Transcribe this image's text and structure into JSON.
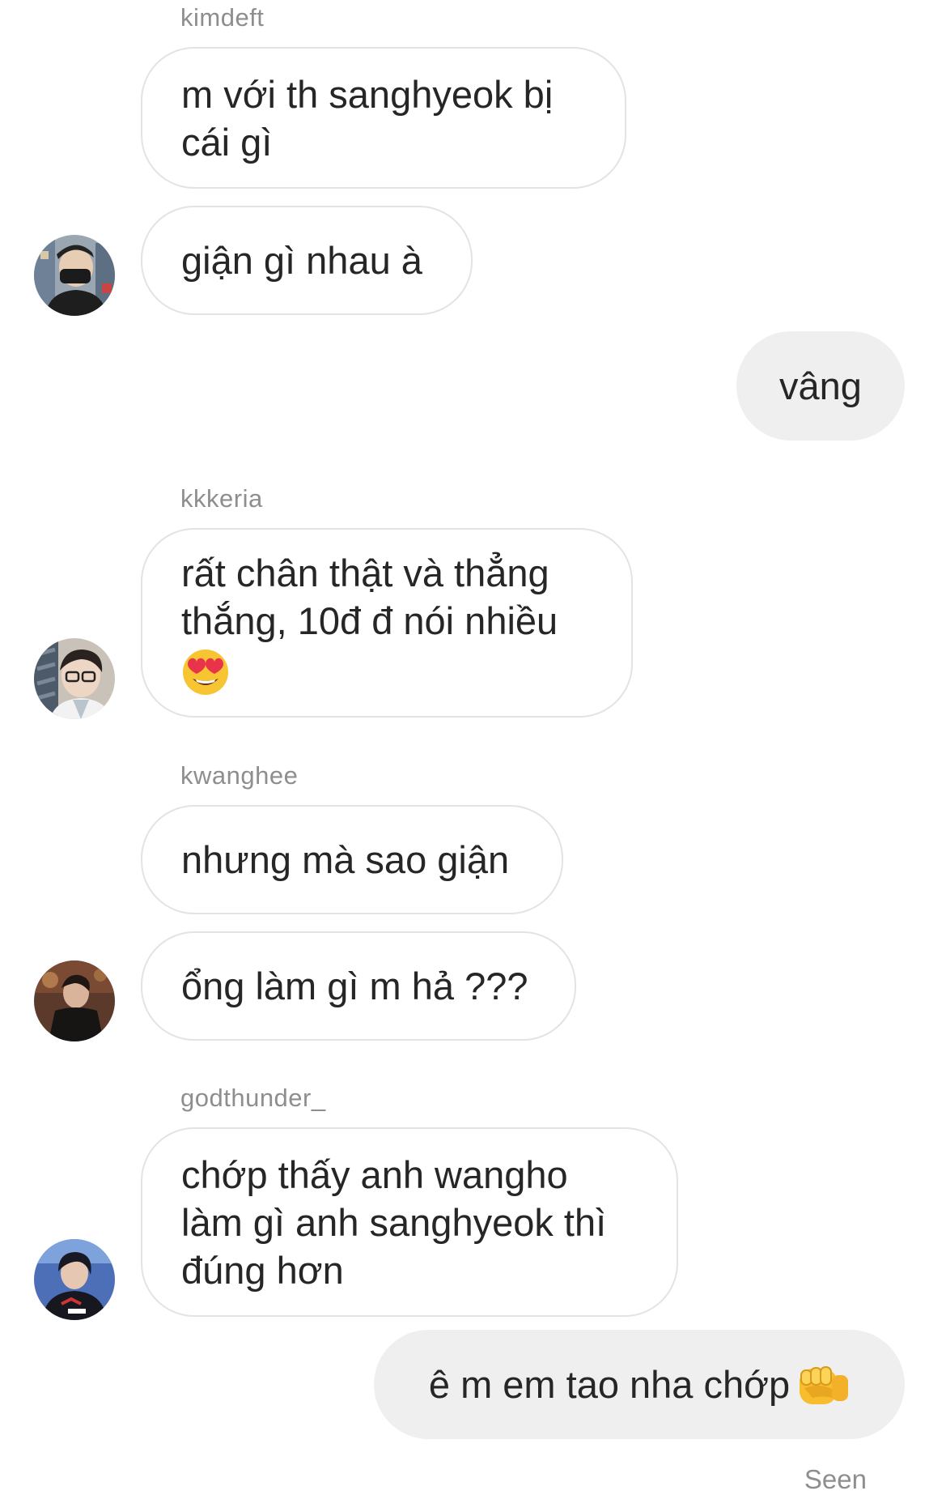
{
  "messages": [
    {
      "sender": "kimdeft",
      "lines": [
        "m với th sanghyeok bị",
        "cái gì"
      ]
    },
    {
      "sender": "kimdeft",
      "lines": [
        "giận gì nhau à"
      ]
    },
    {
      "sender": "me",
      "text": "vâng"
    },
    {
      "sender": "kkkeria",
      "lines": [
        "rất chân thật và thẳng",
        "thắng, 10đ đ nói nhiều"
      ],
      "emoji": "heart-eyes-emoji"
    },
    {
      "sender": "kwanghee",
      "lines": [
        "nhưng mà sao giận"
      ]
    },
    {
      "sender": "kwanghee",
      "lines": [
        "ổng làm gì m hả ???"
      ]
    },
    {
      "sender": "godthunder_",
      "lines": [
        "chớp thấy anh wangho",
        "làm gì anh sanghyeok thì",
        "đúng hơn"
      ]
    },
    {
      "sender": "me",
      "text": "ê m em tao nha chớp",
      "emoji": "oncoming-fist-emoji"
    }
  ],
  "usernames": {
    "kimdeft": "kimdeft",
    "kkkeria": "kkkeria",
    "kwanghee": "kwanghee",
    "godthunder": "godthunder_"
  },
  "status": {
    "seen": "Seen"
  },
  "colors": {
    "incoming_bubble_border": "#e3e3e3",
    "outgoing_bubble_bg": "#efefef",
    "username_text": "#8e8e8e",
    "message_text": "#262626"
  }
}
